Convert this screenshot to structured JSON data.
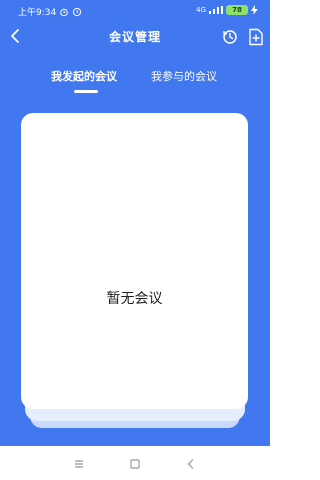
{
  "status_bar": {
    "time": "上午9:34",
    "network": "4G",
    "battery": "78"
  },
  "header": {
    "title": "会议管理"
  },
  "tabs": [
    {
      "label": "我发起的会议",
      "active": true
    },
    {
      "label": "我参与的会议",
      "active": false
    }
  ],
  "empty_state": {
    "text": "暂无会议"
  },
  "colors": {
    "primary": "#4178f0",
    "card": "#ffffff",
    "battery": "#8fe06d"
  }
}
